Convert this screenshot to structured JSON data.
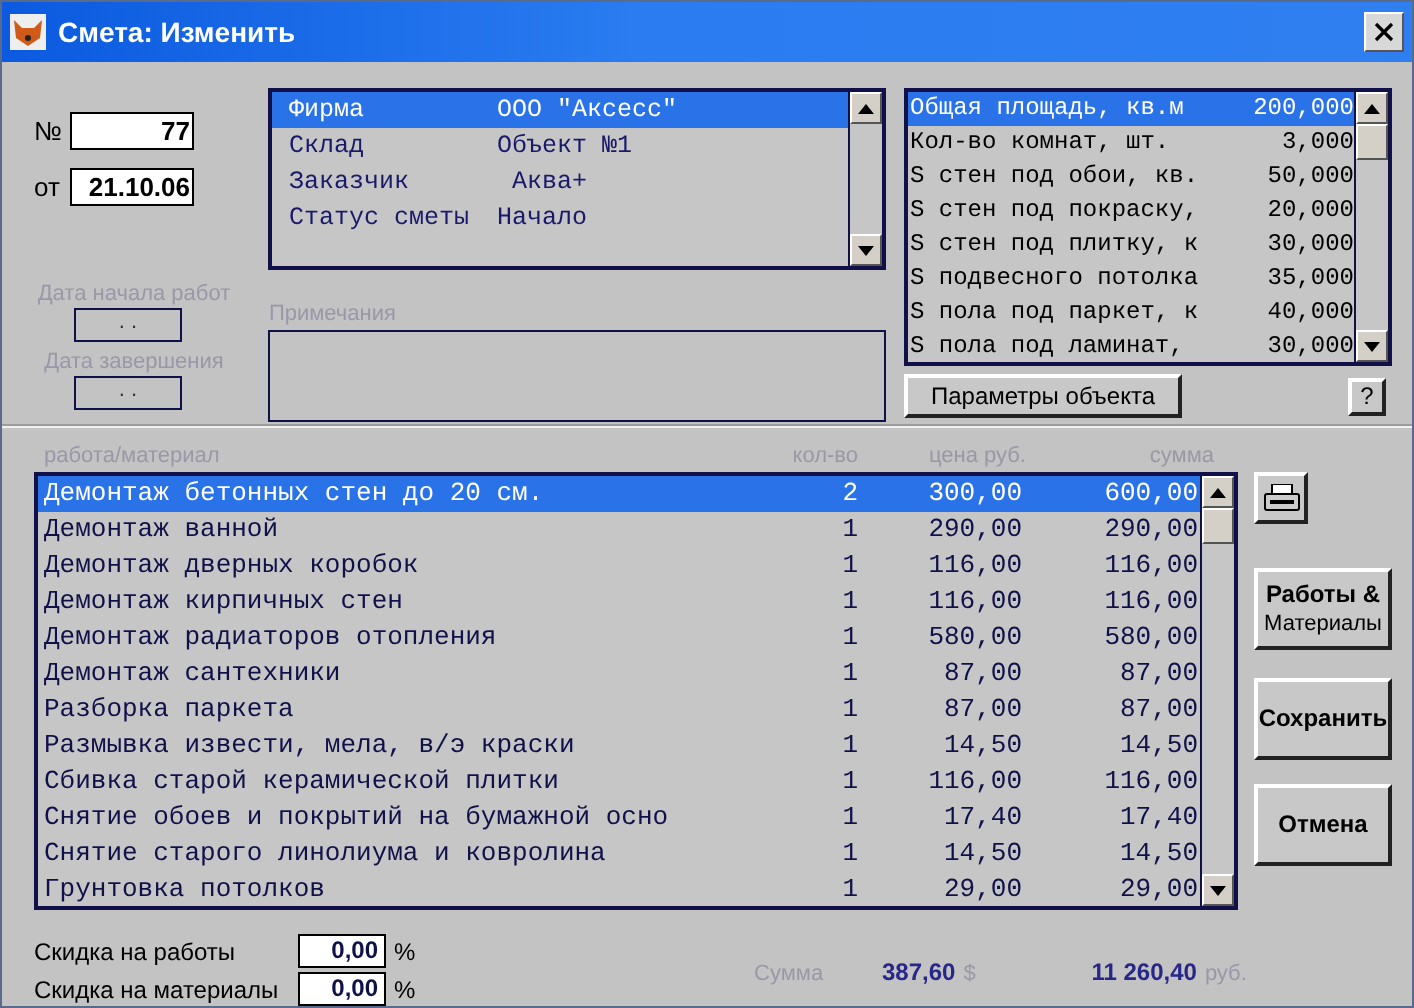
{
  "window": {
    "title": "Смета: Изменить"
  },
  "number": {
    "label": "№",
    "value": "77"
  },
  "date": {
    "label": "от",
    "value": "21.10.06"
  },
  "work_dates": [
    {
      "label": "Дата начала работ",
      "value": ". ."
    },
    {
      "label": "Дата завершения",
      "value": ". ."
    }
  ],
  "info": [
    {
      "name": "Фирма",
      "value": "ООО \"Аксесс\"",
      "selected": true
    },
    {
      "name": "Склад",
      "value": "Объект №1",
      "selected": false
    },
    {
      "name": "Заказчик",
      "value": " Аква+",
      "selected": false
    },
    {
      "name": "Статус сметы",
      "value": "Начало",
      "selected": false
    }
  ],
  "notes": {
    "label": "Примечания"
  },
  "params": [
    {
      "name": "Общая площадь, кв.м",
      "value": "200,000",
      "selected": true
    },
    {
      "name": "Кол-во комнат, шт.",
      "value": "3,000",
      "selected": false
    },
    {
      "name": "S стен под обои, кв.",
      "value": "50,000",
      "selected": false
    },
    {
      "name": "S стен под покраску,",
      "value": "20,000",
      "selected": false
    },
    {
      "name": "S стен под плитку, к",
      "value": "30,000",
      "selected": false
    },
    {
      "name": "S подвесного потолка",
      "value": "35,000",
      "selected": false
    },
    {
      "name": "S пола под паркет, к",
      "value": "40,000",
      "selected": false
    },
    {
      "name": "S пола под ламинат,",
      "value": "30,000",
      "selected": false
    }
  ],
  "params_button": "Параметры объекта",
  "help_button": "?",
  "table": {
    "columns": [
      "работа/материал",
      "кол-во",
      "цена руб.",
      "сумма"
    ],
    "rows": [
      {
        "name": "Демонтаж бетонных стен до 20 см.",
        "qty": "2",
        "price": "300,00",
        "sum": "600,00",
        "selected": true
      },
      {
        "name": "Демонтаж ванной",
        "qty": "1",
        "price": "290,00",
        "sum": "290,00",
        "selected": false
      },
      {
        "name": "Демонтаж дверных коробок",
        "qty": "1",
        "price": "116,00",
        "sum": "116,00",
        "selected": false
      },
      {
        "name": "Демонтаж кирпичных стен",
        "qty": "1",
        "price": "116,00",
        "sum": "116,00",
        "selected": false
      },
      {
        "name": "Демонтаж радиаторов отопления",
        "qty": "1",
        "price": "580,00",
        "sum": "580,00",
        "selected": false
      },
      {
        "name": "Демонтаж сантехники",
        "qty": "1",
        "price": "87,00",
        "sum": "87,00",
        "selected": false
      },
      {
        "name": "Разборка паркета",
        "qty": "1",
        "price": "87,00",
        "sum": "87,00",
        "selected": false
      },
      {
        "name": "Размывка извести, мела, в/э краски",
        "qty": "1",
        "price": "14,50",
        "sum": "14,50",
        "selected": false
      },
      {
        "name": "Сбивка старой керамической плитки",
        "qty": "1",
        "price": "116,00",
        "sum": "116,00",
        "selected": false
      },
      {
        "name": "Снятие обоев и покрытий на бумажной осно",
        "qty": "1",
        "price": "17,40",
        "sum": "17,40",
        "selected": false
      },
      {
        "name": "Снятие старого линолиума и ковролина",
        "qty": "1",
        "price": "14,50",
        "sum": "14,50",
        "selected": false
      },
      {
        "name": "Грунтовка потолков",
        "qty": "1",
        "price": "29,00",
        "sum": "29,00",
        "selected": false
      }
    ]
  },
  "actions": [
    {
      "kind": "two-line",
      "lines": [
        "Работы &",
        "Материалы"
      ]
    },
    {
      "kind": "single",
      "lines": [
        "Сохранить"
      ]
    },
    {
      "kind": "single",
      "lines": [
        "Отмена"
      ]
    }
  ],
  "discounts": [
    {
      "label": "Скидка на работы",
      "value": "0,00",
      "unit": "%"
    },
    {
      "label": "Скидка на материалы",
      "value": "0,00",
      "unit": "%"
    }
  ],
  "total": {
    "label": "Сумма",
    "usd": "387,60",
    "usd_unit": "$",
    "rub": "11 260,40",
    "rub_unit": "руб."
  }
}
